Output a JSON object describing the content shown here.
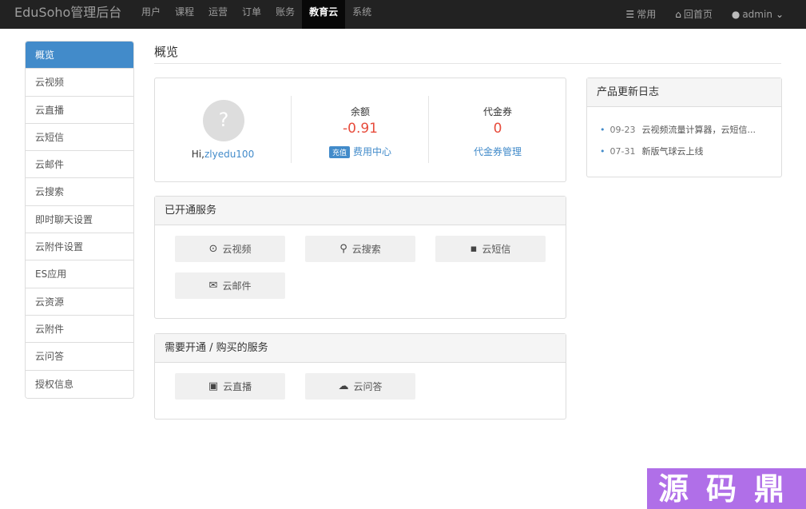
{
  "brand": "EduSoho管理后台",
  "nav": {
    "items": [
      "用户",
      "课程",
      "运营",
      "订单",
      "账务",
      "教育云",
      "系统"
    ],
    "active_index": 5,
    "right": {
      "common": "常用",
      "home": "回首页",
      "user": "admin"
    }
  },
  "sidebar": {
    "items": [
      "概览",
      "云视频",
      "云直播",
      "云短信",
      "云邮件",
      "云搜索",
      "即时聊天设置",
      "云附件设置",
      "ES应用",
      "云资源",
      "云附件",
      "云问答",
      "授权信息"
    ],
    "active_index": 0
  },
  "page_title": "概览",
  "overview": {
    "avatar_glyph": "?",
    "greeting": "Hi,",
    "username": "zlyedu100",
    "balance_label": "余额",
    "balance_value": "-0.91",
    "recharge_label": "充值",
    "fee_center": "费用中心",
    "voucher_label": "代金券",
    "voucher_value": "0",
    "voucher_manage": "代金券管理"
  },
  "opened_services": {
    "title": "已开通服务",
    "items": [
      {
        "label": "云视频",
        "icon": "play-circle-icon"
      },
      {
        "label": "云搜索",
        "icon": "search-icon"
      },
      {
        "label": "云短信",
        "icon": "comment-icon"
      },
      {
        "label": "云邮件",
        "icon": "envelope-icon"
      }
    ]
  },
  "needed_services": {
    "title": "需要开通 / 购买的服务",
    "items": [
      {
        "label": "云直播",
        "icon": "tv-icon"
      },
      {
        "label": "云问答",
        "icon": "cloud-question-icon"
      }
    ]
  },
  "changelog": {
    "title": "产品更新日志",
    "items": [
      {
        "date": "09-23",
        "text": "云视频流量计算器，云短信..."
      },
      {
        "date": "07-31",
        "text": "新版气球云上线"
      }
    ]
  },
  "watermark": "源码鼎",
  "colors": {
    "navbar": "#222222",
    "accent": "#428bca",
    "negative": "#e74c3c",
    "watermark": "#b06fe8"
  }
}
